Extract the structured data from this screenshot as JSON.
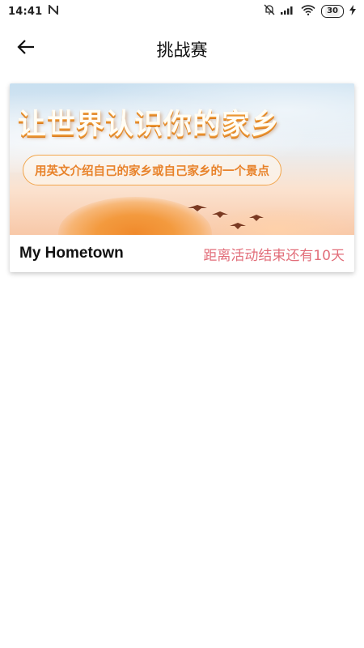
{
  "status_bar": {
    "time": "14:41",
    "notification_icon": "n-icon",
    "battery": "30"
  },
  "app_bar": {
    "title": "挑战赛",
    "back_icon": "arrow-left-icon"
  },
  "challenge": {
    "banner_headline": "让世界认识你的家乡",
    "banner_subtitle": "用英文介绍自己的家乡或自己家乡的一个景点",
    "title": "My Hometown",
    "countdown": "距离活动结束还有10天"
  },
  "colors": {
    "countdown": "#e26e7a",
    "banner_accent": "#e8822a"
  }
}
